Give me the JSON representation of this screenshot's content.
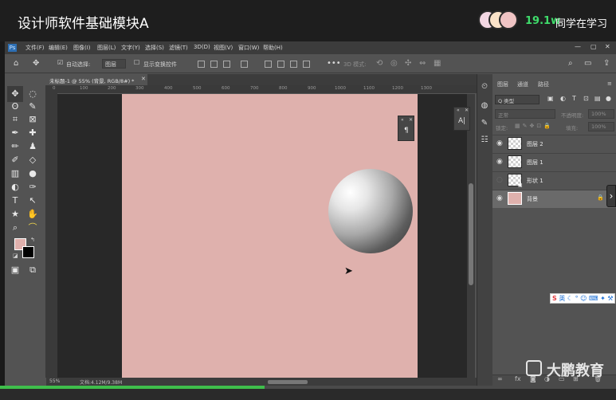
{
  "video": {
    "title": "设计师软件基础模块A",
    "viewer_count": "19.1w",
    "viewer_label": "同学在学习",
    "progress": 0.43,
    "accent_color": "#3fdc6b"
  },
  "menu": {
    "items": [
      "文件(F)",
      "编辑(E)",
      "图像(I)",
      "图层(L)",
      "文字(Y)",
      "选择(S)",
      "滤镜(T)",
      "3D(D)",
      "视图(V)",
      "窗口(W)",
      "帮助(H)"
    ]
  },
  "options": {
    "auto_select_label": "自动选择:",
    "auto_select_value": "图层",
    "show_transform_label": "显示变换控件",
    "mode_3d": "3D 模式:"
  },
  "document": {
    "tab_label": "未标题-1 @ 55% (背景, RGB/8#) *",
    "ruler_labels": [
      "0",
      "100",
      "200",
      "300",
      "400",
      "500",
      "600",
      "700",
      "800",
      "900",
      "1000",
      "1100",
      "1200",
      "1300"
    ],
    "zoom": "55%",
    "file_info": "文档:4.12M/9.38M",
    "canvas_color": "#dfb1ad"
  },
  "layers_panel": {
    "tabs": [
      "图层",
      "通道",
      "路径"
    ],
    "filter_label": "Q 类型",
    "blend_mode": "正常",
    "opacity_label": "不透明度:",
    "opacity_value": "100%",
    "lock_label": "锁定:",
    "fill_label": "填充:",
    "fill_value": "100%",
    "layers": [
      {
        "name": "图层 2"
      },
      {
        "name": "图层 1"
      },
      {
        "name": "形状 1"
      },
      {
        "name": "背景"
      }
    ]
  },
  "ime": {
    "text": "英"
  },
  "watermark": {
    "text": "大鹏教育"
  }
}
